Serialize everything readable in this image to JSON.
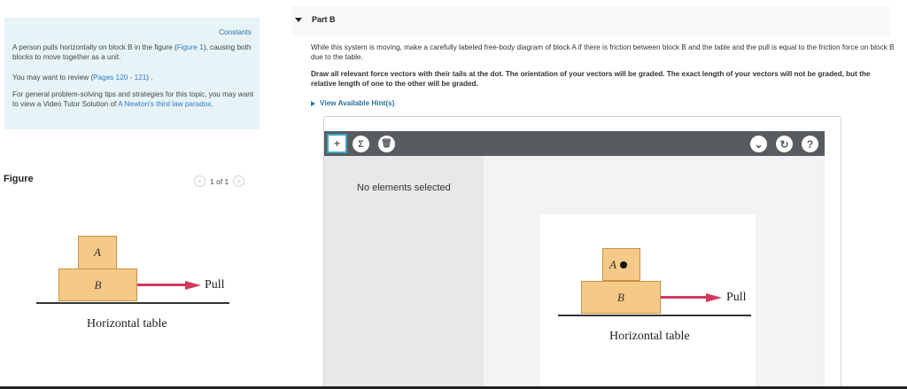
{
  "left": {
    "constants_label": "Constants",
    "intro_text": "A person pulls horizontally on block B in the figure (",
    "figure_link": "Figure 1",
    "intro_text_end": "), causing both blocks to move together as a unit.",
    "review_text": "You may want to review (",
    "pages_link": "Pages 120 - 121",
    "review_text_end": ") .",
    "tips_text": "For general problem-solving tips and strategies for this topic, you may want to view a Video Tutor Solution of ",
    "tutor_link": "A Newton's third law paradox",
    "tips_text_end": ".",
    "figure_label": "Figure",
    "pager_text": "1 of 1",
    "pager_prev": "<",
    "pager_next": ">"
  },
  "figure": {
    "block_a": "A",
    "block_b": "B",
    "pull": "Pull",
    "table": "Horizontal table"
  },
  "part_b": {
    "title": "Part B",
    "question": "While this system is moving, make a carefully labeled free-body diagram of block A if there is friction between block B and the table and the pull is equal to the friction force on block B due to the table.",
    "instructions": "Draw all relevant force vectors with their tails at the dot. The orientation of your vectors will be graded. The exact length of your vectors will not be graded, but the relative length of one to the other will be graded.",
    "hint_label": "View Available Hint(s)"
  },
  "widget": {
    "tools": {
      "add": "+",
      "sum": "Σ",
      "trash": "🗑"
    },
    "right_tools": {
      "dropdown": "⌄",
      "reset": "↻",
      "help": "?"
    },
    "no_selection": "No elements selected",
    "block_a": "A",
    "block_b": "B",
    "pull": "Pull",
    "table": "Horizontal table"
  },
  "colors": {
    "accent": "#2f6f9c",
    "arrow": "#d4375e",
    "block_fill": "#f5c987",
    "info_bg": "#e7f4f7",
    "toolbar": "#585c60"
  }
}
